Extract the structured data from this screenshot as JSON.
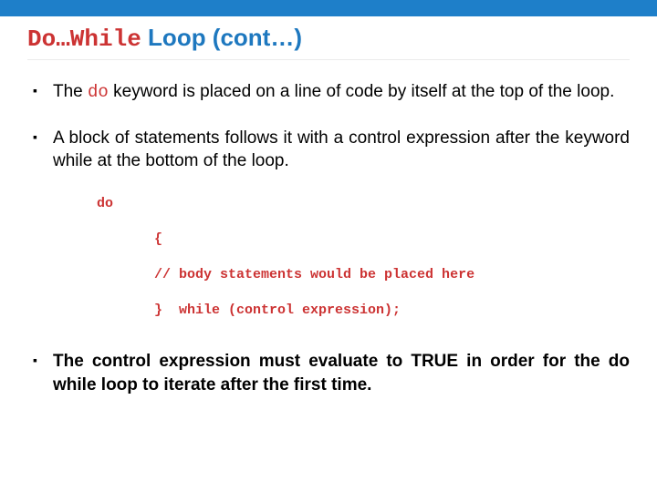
{
  "title": {
    "code_part": "Do…While",
    "rest": " Loop (cont…)"
  },
  "bullets": {
    "b1": {
      "pre": "The ",
      "code": "do",
      "post": " keyword is placed on a line of code by itself at the top of the loop."
    },
    "b2": {
      "text": "A block of statements follows it with a control expression after the keyword while at the bottom of the loop."
    },
    "code": {
      "l1": "do",
      "l2": "       {",
      "l3": "       // body statements would be placed here",
      "l4": "       }  while (control expression);"
    },
    "b3": {
      "text": "The control expression must evaluate to TRUE in order for the do while loop to iterate after the first time."
    }
  }
}
